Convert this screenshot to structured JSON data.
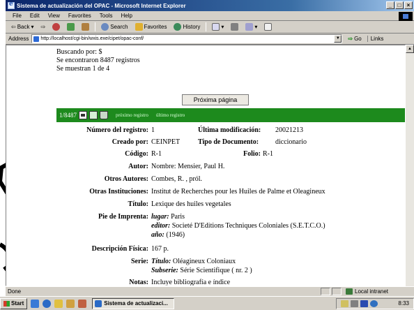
{
  "window": {
    "title": "Sistema de actualización del OPAC - Microsoft Internet Explorer",
    "controls": [
      "_",
      "□",
      "×"
    ]
  },
  "menu": [
    "File",
    "Edit",
    "View",
    "Favorites",
    "Tools",
    "Help"
  ],
  "toolbar": {
    "back": "Back",
    "search": "Search",
    "favorites": "Favorites",
    "history": "History"
  },
  "address": {
    "label": "Address",
    "url": "http://localhost/cgi-bin/wxis.exe/cipet/opac-conf/",
    "go": "Go",
    "links": "Links"
  },
  "results": {
    "search_by": "Buscando por: $",
    "found": "Se encontraron 8487 registros",
    "showing": "Se muestran 1 de 4",
    "next_page": "Próxima página"
  },
  "record_nav": {
    "counter": "1/8487",
    "next_record": "próximo registro",
    "last_record": "último registro"
  },
  "record": {
    "numero_label": "Número del registro:",
    "numero_value": "1",
    "ultima_label": "Última modificación:",
    "ultima_value": "20021213",
    "creado_label": "Creado por:",
    "creado_value": "CEINPET",
    "tipo_label": "Tipo de Documento:",
    "tipo_value": "diccionario",
    "codigo_label": "Código:",
    "codigo_value": "R-1",
    "folio_label": "Folio:",
    "folio_value": "R-1",
    "autor_label": "Autor:",
    "autor_value": "Nombre: Mensier, Paul H.",
    "otros_autores_label": "Otros Autores:",
    "otros_autores_value": "Combes, R. , pról.",
    "otras_inst_label": "Otras Instituciones:",
    "otras_inst_value": "Institut de Recherches pour les Huiles de Palme et Oleagineux",
    "titulo_label": "Título:",
    "titulo_value": "Lexique des huiles vegetales",
    "imprenta_label": "Pie de Imprenta:",
    "lugar_sub": "lugar:",
    "lugar_value": "Paris",
    "editor_sub": "editor:",
    "editor_value": "Societé D'Editions Techniques Coloniales (S.E.T.C.O.)",
    "anio_sub": "año:",
    "anio_value": "(1946)",
    "desc_label": "Descripción Física:",
    "desc_value": "167 p.",
    "serie_label": "Serie:",
    "serie_titulo_sub": "Título:",
    "serie_titulo_value": "Oléagineux Coloniaux",
    "subserie_sub": "Subserie:",
    "subserie_value": "Série Scientifique ( nr. 2 )",
    "notas_label": "Notas:",
    "notas_value": "Incluye bibliografía e índice"
  },
  "status": {
    "text": "Done",
    "zone": "Local intranet"
  },
  "taskbar": {
    "start": "Start",
    "task": "Sistema de actualizaci...",
    "clock": "8:33"
  },
  "colors": {
    "green_bar": "#1d8a1d",
    "title_blue": "#0a246a"
  }
}
